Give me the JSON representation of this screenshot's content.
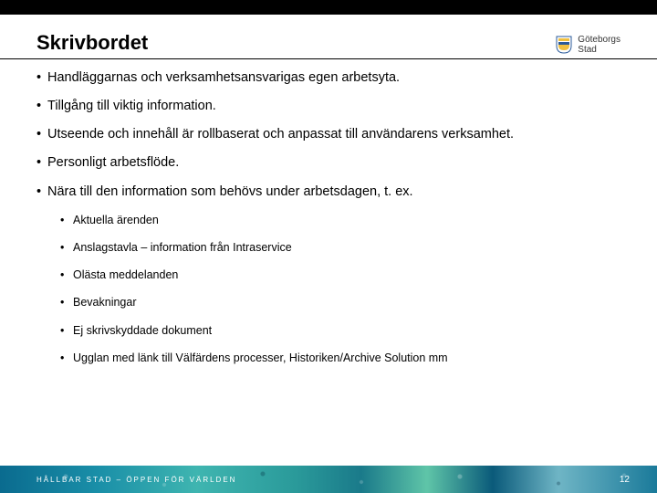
{
  "header": {
    "title": "Skrivbordet",
    "logo_line1": "Göteborgs",
    "logo_line2": "Stad"
  },
  "bullets": [
    "Handläggarnas och verksamhetsansvarigas egen arbetsyta.",
    "Tillgång till viktig information.",
    "Utseende och innehåll är rollbaserat och anpassat till användarens verksamhet.",
    " Personligt arbetsflöde.",
    " Nära till den information som behövs under arbetsdagen, t. ex."
  ],
  "sub_bullets": [
    "Aktuella ärenden",
    "Anslagstavla – information från Intraservice",
    "Olästa meddelanden",
    "Bevakningar",
    "Ej skrivskyddade dokument",
    "Ugglan med länk till Välfärdens processer, Historiken/Archive Solution mm"
  ],
  "footer": {
    "tagline": "HÅLLBAR STAD – ÖPPEN FÖR VÄRLDEN",
    "page": "12"
  }
}
